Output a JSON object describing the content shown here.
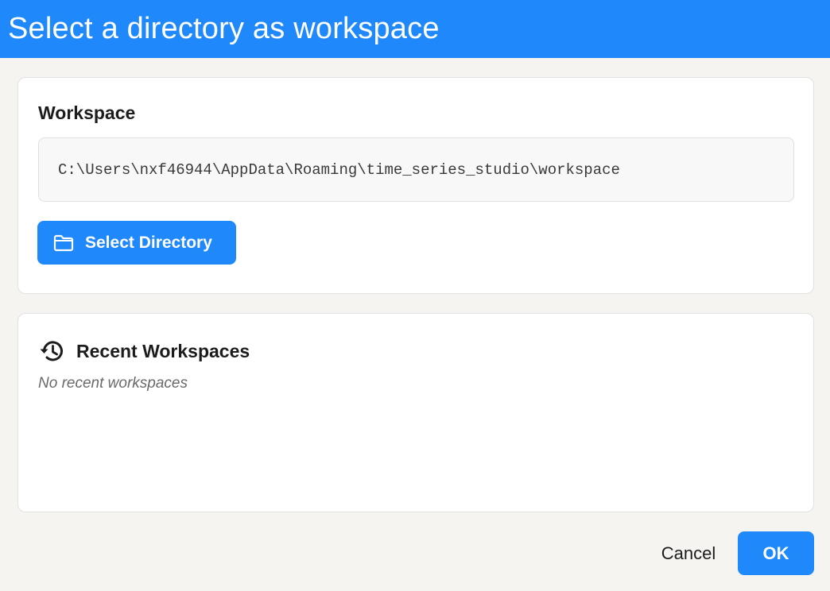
{
  "window": {
    "title": "Select a directory as workspace"
  },
  "workspace": {
    "heading": "Workspace",
    "path": "C:\\Users\\nxf46944\\AppData\\Roaming\\time_series_studio\\workspace",
    "select_button_label": "Select Directory",
    "select_button_icon": "folder-icon"
  },
  "recent": {
    "heading": "Recent Workspaces",
    "heading_icon": "history-icon",
    "empty_message": "No recent workspaces"
  },
  "footer": {
    "cancel_label": "Cancel",
    "ok_label": "OK"
  },
  "colors": {
    "accent": "#1f88fb",
    "background": "#f5f4f1",
    "card": "#ffffff"
  }
}
